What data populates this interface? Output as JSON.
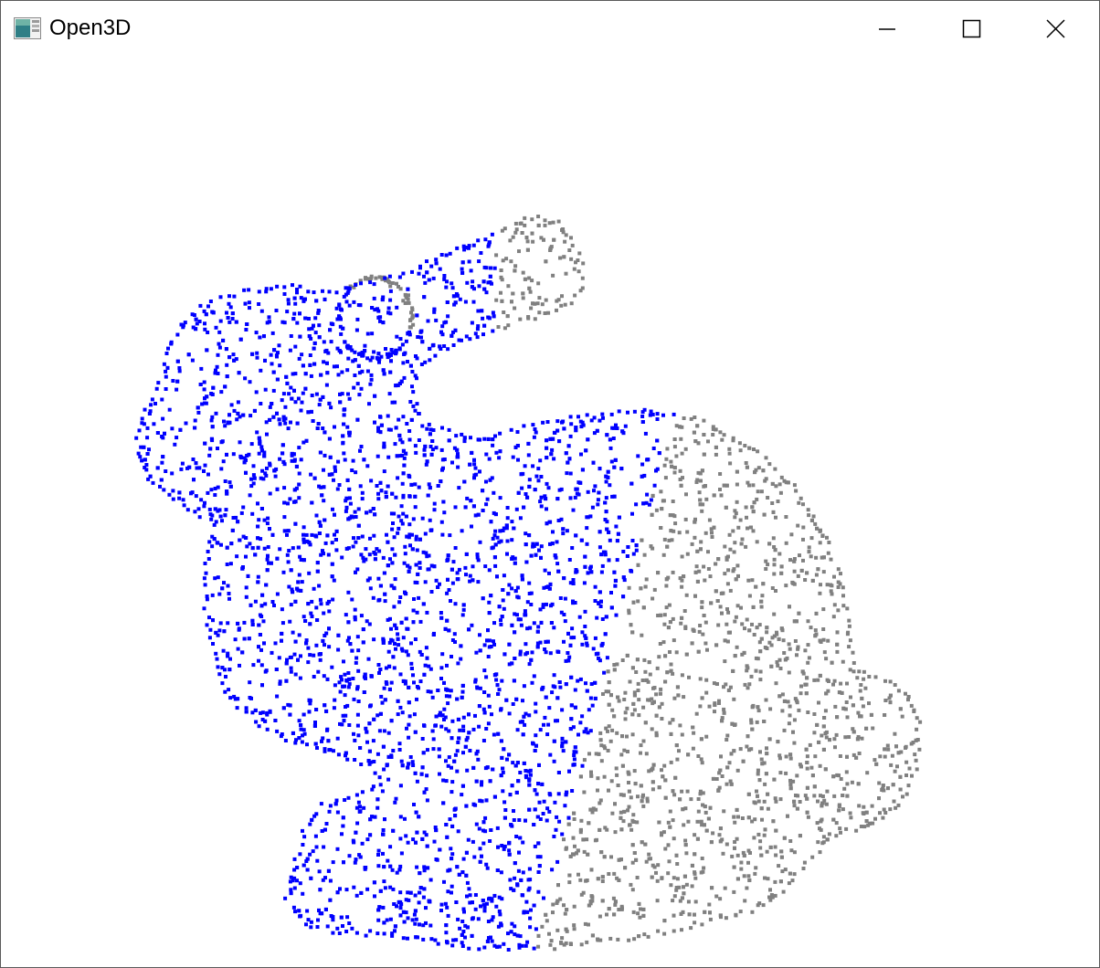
{
  "window": {
    "title": "Open3D",
    "icon": "open3d-app-icon",
    "controls": {
      "minimize": "minimize-icon",
      "maximize": "maximize-icon",
      "close": "close-icon"
    }
  },
  "scene": {
    "object": "bunny-point-cloud",
    "background_color": "#ffffff",
    "colors": {
      "segment_a": "#0000ff",
      "segment_b": "#808080"
    }
  }
}
